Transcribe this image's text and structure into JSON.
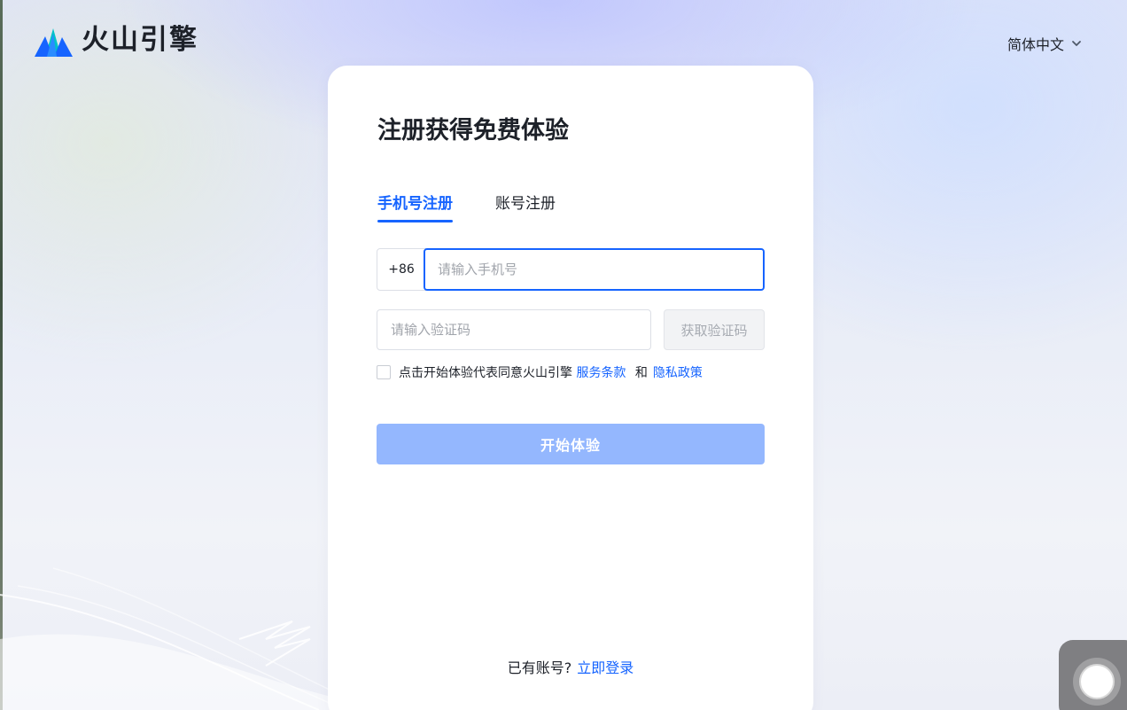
{
  "header": {
    "brand_name": "火山引擎",
    "language": "简体中文"
  },
  "form": {
    "title": "注册获得免费体验",
    "tabs": [
      {
        "label": "手机号注册",
        "active": true
      },
      {
        "label": "账号注册",
        "active": false
      }
    ],
    "phone": {
      "prefix": "+86",
      "placeholder": "请输入手机号",
      "value": ""
    },
    "code": {
      "placeholder": "请输入验证码",
      "value": "",
      "button_label": "获取验证码"
    },
    "agreement": {
      "checked": false,
      "text": "点击开始体验代表同意火山引擎",
      "terms_link": "服务条款",
      "and": "和",
      "privacy_link": "隐私政策"
    },
    "submit_label": "开始体验",
    "login_prompt": "已有账号?",
    "login_link": "立即登录"
  },
  "colors": {
    "accent": "#1664ff",
    "submit_disabled": "#94b7fe",
    "text": "#1d2129",
    "placeholder": "#a0a4ab"
  },
  "icons": {
    "logo": "volcano-mountain-logo-icon",
    "language_toggle": "chevron-down-icon",
    "assistant": "floating-assistant-icon"
  }
}
